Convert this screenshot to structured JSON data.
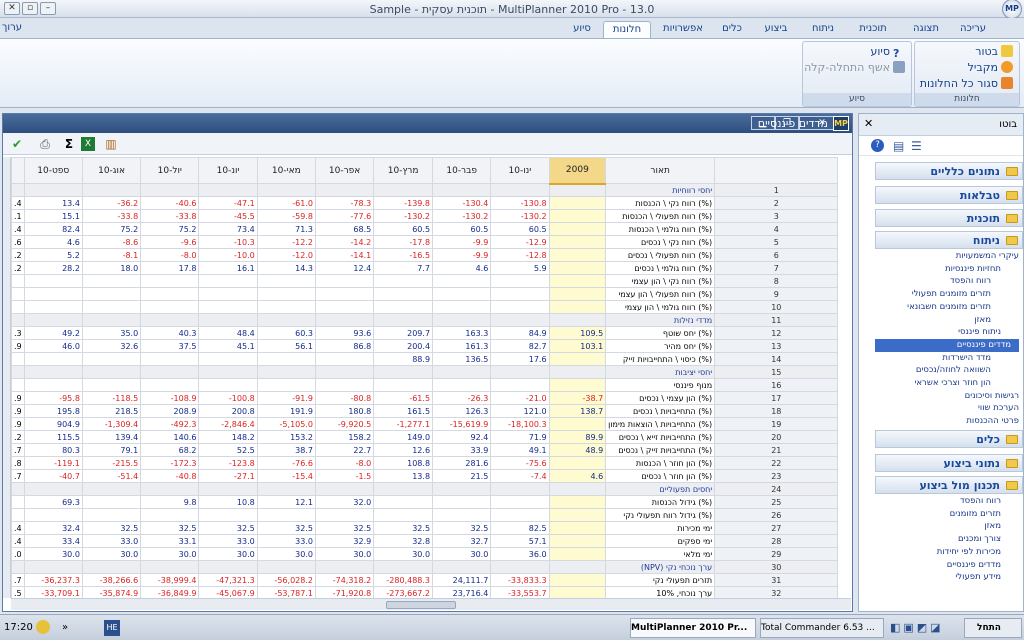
{
  "app": {
    "title": "Sample - תוכנית עסקית - MultiPlanner 2010 Pro - 13.0",
    "menu_right": "ערוך"
  },
  "ribbon": {
    "tabs": [
      "עריכה",
      "תצוגה",
      "תוכנית",
      "ניתוח",
      "ביצוע",
      "כלים",
      "אפשרויות",
      "חלונות",
      "סיוע"
    ],
    "active_tab": "חלונות",
    "group_windows": {
      "label": "חלונות",
      "items": [
        "בטור",
        "מקביל",
        "סגור כל החלונות"
      ]
    },
    "group_help": {
      "label": "סיוע",
      "items": [
        "סיוע",
        "אשף התחלה-קלה"
      ]
    }
  },
  "doc": {
    "title": "מדדים פיננסיים",
    "logo": "MP"
  },
  "table": {
    "headers": [
      "תאור",
      "2009",
      "ינו-10",
      "פבר-10",
      "מרץ-10",
      "אפר-10",
      "מאי-10",
      "יונ-10",
      "יול-10",
      "אוג-10",
      "ספט-10"
    ],
    "rows": [
      {
        "n": "1",
        "d": "יחסי רווחיות",
        "sec": true,
        "v": [
          "",
          "",
          "",
          "",
          "",
          "",
          "",
          "",
          "",
          ""
        ],
        "e": ""
      },
      {
        "n": "2",
        "d": "(%) רווח נקי \\ הכנסות",
        "v": [
          "",
          "-130.8",
          "-130.4",
          "-139.8",
          "-78.3",
          "-61.0",
          "-47.1",
          "-40.6",
          "-36.2",
          "13.4"
        ],
        "e": ".4"
      },
      {
        "n": "3",
        "d": "(%) רווח תפעולי \\ הכנסות",
        "v": [
          "",
          "-130.2",
          "-130.2",
          "-130.2",
          "-77.6",
          "-59.8",
          "-45.5",
          "-33.8",
          "-33.8",
          "15.1"
        ],
        "e": ".1"
      },
      {
        "n": "4",
        "d": "(%) רווח גולמי \\ הכנסות",
        "v": [
          "",
          "60.5",
          "60.5",
          "60.5",
          "68.5",
          "71.3",
          "73.4",
          "75.2",
          "75.2",
          "82.4"
        ],
        "e": ".4"
      },
      {
        "n": "5",
        "d": "(%) רווח נקי \\ נכסים",
        "v": [
          "",
          "-12.9",
          "-9.9",
          "-17.8",
          "-14.2",
          "-12.2",
          "-10.3",
          "-9.6",
          "-8.6",
          "4.6"
        ],
        "e": ".6"
      },
      {
        "n": "6",
        "d": "(%) רווח תפעולי \\ נכסים",
        "v": [
          "",
          "-12.8",
          "-9.9",
          "-16.5",
          "-14.1",
          "-12.0",
          "-10.0",
          "-8.0",
          "-8.1",
          "5.2"
        ],
        "e": ".2"
      },
      {
        "n": "7",
        "d": "(%) רווח גולמי \\ נכסים",
        "v": [
          "",
          "5.9",
          "4.6",
          "7.7",
          "12.4",
          "14.3",
          "16.1",
          "17.8",
          "18.0",
          "28.2"
        ],
        "e": ".2"
      },
      {
        "n": "8",
        "d": "(%) רווח נקי \\ הון עצמי",
        "v": [
          "",
          "",
          "",
          "",
          "",
          "",
          "",
          "",
          "",
          ""
        ],
        "e": ""
      },
      {
        "n": "9",
        "d": "(%) רווח תפעולי \\ הון עצמי",
        "v": [
          "",
          "",
          "",
          "",
          "",
          "",
          "",
          "",
          "",
          ""
        ],
        "e": ""
      },
      {
        "n": "10",
        "d": "(%) רווח גולמי \\ הון עצמי",
        "v": [
          "",
          "",
          "",
          "",
          "",
          "",
          "",
          "",
          "",
          ""
        ],
        "e": ""
      },
      {
        "n": "11",
        "d": "מדדי נזילות",
        "sec": true,
        "v": [
          "",
          "",
          "",
          "",
          "",
          "",
          "",
          "",
          "",
          ""
        ],
        "e": ""
      },
      {
        "n": "12",
        "d": "(%) יחס שוטף",
        "v": [
          "109.5",
          "84.9",
          "163.3",
          "209.7",
          "93.6",
          "60.3",
          "48.4",
          "40.3",
          "35.0",
          "49.2"
        ],
        "e": ".3"
      },
      {
        "n": "13",
        "d": "(%) יחס מהיר",
        "v": [
          "103.1",
          "82.7",
          "161.3",
          "200.4",
          "86.8",
          "56.1",
          "45.1",
          "37.5",
          "32.6",
          "46.0"
        ],
        "e": ".9"
      },
      {
        "n": "14",
        "d": "(%) כיסוי \\ התחייבויות זייק",
        "v": [
          "",
          "17.6",
          "136.5",
          "88.9",
          "",
          "",
          "",
          "",
          "",
          ""
        ],
        "e": ""
      },
      {
        "n": "15",
        "d": "יחסי יציבות",
        "sec": true,
        "v": [
          "",
          "",
          "",
          "",
          "",
          "",
          "",
          "",
          "",
          ""
        ],
        "e": ""
      },
      {
        "n": "16",
        "d": "מנוף פיננסי",
        "v": [
          "",
          "",
          "",
          "",
          "",
          "",
          "",
          "",
          "",
          ""
        ],
        "e": ""
      },
      {
        "n": "17",
        "d": "(%) הון עצמי \\ נכסים",
        "v": [
          "-38.7",
          "-21.0",
          "-26.3",
          "-61.5",
          "-80.8",
          "-91.9",
          "-100.8",
          "-108.9",
          "-118.5",
          "-95.8"
        ],
        "e": ".9"
      },
      {
        "n": "18",
        "d": "(%) התחייבויות \\ נכסים",
        "v": [
          "138.7",
          "121.0",
          "126.3",
          "161.5",
          "180.8",
          "191.9",
          "200.8",
          "208.9",
          "218.5",
          "195.8"
        ],
        "e": ".9"
      },
      {
        "n": "19",
        "d": "(%) התחייבויות \\ הוצאות מימון",
        "v": [
          "",
          "-18,100.3",
          "-15,619.9",
          "-1,277.1",
          "-9,920.5",
          "-5,105.0",
          "-2,846.4",
          "-492.3",
          "-1,309.4",
          "904.9"
        ],
        "e": ".9"
      },
      {
        "n": "20",
        "d": "(%) התחייבויות זייא \\ נכסים",
        "v": [
          "89.9",
          "71.9",
          "92.4",
          "149.0",
          "158.2",
          "153.2",
          "148.2",
          "140.6",
          "139.4",
          "115.5"
        ],
        "e": ".2"
      },
      {
        "n": "21",
        "d": "(%) התחייבויות זייק \\ נכסים",
        "v": [
          "48.9",
          "49.1",
          "33.9",
          "12.6",
          "22.7",
          "38.7",
          "52.5",
          "68.2",
          "79.1",
          "80.3"
        ],
        "e": ".7"
      },
      {
        "n": "22",
        "d": "(%) הון חוזר \\ הכנסות",
        "v": [
          "",
          "-75.6",
          "281.6",
          "108.8",
          "-8.0",
          "-76.6",
          "-123.8",
          "-172.3",
          "-215.5",
          "-119.1"
        ],
        "e": ".8"
      },
      {
        "n": "23",
        "d": "(%) הון חוזר \\ נכסים",
        "v": [
          "4.6",
          "-7.4",
          "21.5",
          "13.8",
          "-1.5",
          "-15.4",
          "-27.1",
          "-40.8",
          "-51.4",
          "-40.7"
        ],
        "e": ".7"
      },
      {
        "n": "24",
        "d": "יחסים תפעוליים",
        "sec": true,
        "v": [
          "",
          "",
          "",
          "",
          "",
          "",
          "",
          "",
          "",
          ""
        ],
        "e": ""
      },
      {
        "n": "25",
        "d": "(%) גידול הכנסות",
        "v": [
          "",
          "",
          "",
          "",
          "32.0",
          "12.1",
          "10.8",
          "9.8",
          "",
          "69.3"
        ],
        "e": ""
      },
      {
        "n": "26",
        "d": "(%) גידול רווח תפעולי נקי",
        "v": [
          "",
          "",
          "",
          "",
          "",
          "",
          "",
          "",
          "",
          ""
        ],
        "e": ""
      },
      {
        "n": "27",
        "d": "ימי מכירות",
        "v": [
          "",
          "82.5",
          "32.5",
          "32.5",
          "32.5",
          "32.5",
          "32.5",
          "32.5",
          "32.5",
          "32.4"
        ],
        "e": ".4"
      },
      {
        "n": "28",
        "d": "ימי ספקים",
        "v": [
          "",
          "57.1",
          "32.7",
          "32.8",
          "32.9",
          "33.0",
          "33.0",
          "33.1",
          "33.0",
          "33.4"
        ],
        "e": ".4"
      },
      {
        "n": "29",
        "d": "ימי מלאי",
        "v": [
          "",
          "36.0",
          "30.0",
          "30.0",
          "30.0",
          "30.0",
          "30.0",
          "30.0",
          "30.0",
          "30.0"
        ],
        "e": ".0"
      },
      {
        "n": "30",
        "d": "ערך נוכחי נקי (NPV)",
        "sec": true,
        "v": [
          "",
          "",
          "",
          "",
          "",
          "",
          "",
          "",
          "",
          ""
        ],
        "e": ""
      },
      {
        "n": "31",
        "d": "תזרים תפעולי נקי",
        "v": [
          "",
          "-33,833.3",
          "24,111.7",
          "-280,488.3",
          "-74,318.2",
          "-56,028.2",
          "-47,321.3",
          "-38,999.4",
          "-38,266.6",
          "-36,237.3"
        ],
        "e": ".7"
      },
      {
        "n": "32",
        "d": "ערך נוכחי, 10%",
        "v": [
          "",
          "-33,553.7",
          "23,716.4",
          "-273,667.2",
          "-71,920.8",
          "-53,787.1",
          "-45,067.9",
          "-36,849.9",
          "-35,874.9",
          "-33,709.1"
        ],
        "e": ".5"
      }
    ]
  },
  "sidebar": {
    "title": "בוטו",
    "headers": [
      "נתונים כלליים",
      "טבלאות",
      "תוכנית",
      "ניתוח",
      "כלים",
      "נתוני ביצוע",
      "תכנון מול ביצוע"
    ],
    "analysis_items": [
      "עיקרי המשמעויות",
      "תחזיות פיננסיות",
      "רווח והפסד",
      "תזרים מזומנים תפעולי",
      "תזרים מזומנים חשבונאי",
      "מאזן",
      "ניתוח פיננסי",
      "מדדים פיננסיים",
      "מדד הישרדות",
      "השוואה לחוזה/נכסים",
      "הון חוזר וצרכי אשראי",
      "רגישות וסיכונים",
      "הערכת שווי",
      "פרטי ההכנסות"
    ],
    "perf_items": [
      "רווח והפסד",
      "תזרים מזומנים",
      "מאזן",
      "צורך ומכנים",
      "מכירות לפי יחידות",
      "מדדים פיננסיים",
      "מידע תפעולי"
    ]
  },
  "taskbar": {
    "start": "התחל",
    "tc": "Total Commander 6.53 ...",
    "mp": "MultiPlanner 2010 Pr...",
    "time": "17:20",
    "he": "HE"
  }
}
